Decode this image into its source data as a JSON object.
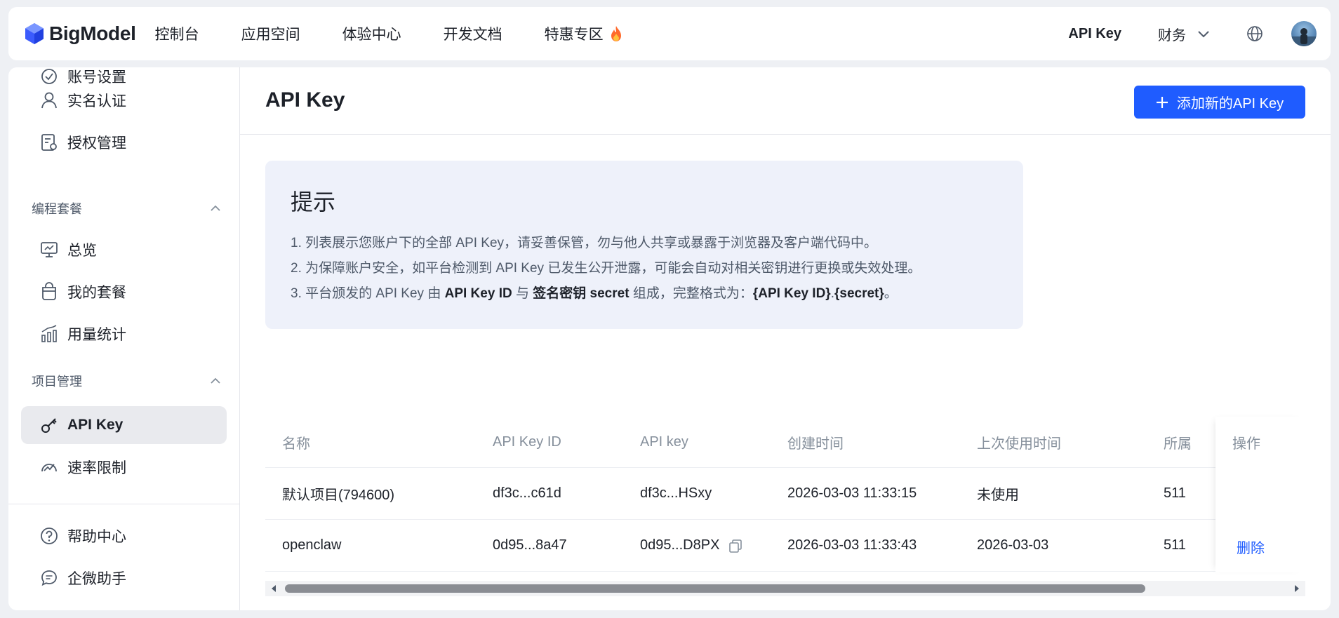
{
  "brand": {
    "name": "BigModel"
  },
  "nav": {
    "items": [
      {
        "label": "控制台"
      },
      {
        "label": "应用空间"
      },
      {
        "label": "体验中心"
      },
      {
        "label": "开发文档"
      },
      {
        "label": "特惠专区"
      }
    ],
    "api_key_label": "API Key",
    "finance_label": "财务"
  },
  "sidebar": {
    "top_partial": "账号设置",
    "account_items": [
      {
        "label": "实名认证",
        "icon": "user-icon"
      },
      {
        "label": "授权管理",
        "icon": "authorization-icon"
      }
    ],
    "group_coding": "编程套餐",
    "coding_items": [
      {
        "label": "总览",
        "icon": "monitor-icon"
      },
      {
        "label": "我的套餐",
        "icon": "package-icon"
      },
      {
        "label": "用量统计",
        "icon": "bar-chart-icon"
      }
    ],
    "group_project": "项目管理",
    "project_items": [
      {
        "label": "API Key",
        "icon": "key-icon",
        "active": true
      },
      {
        "label": "速率限制",
        "icon": "rate-limit-icon"
      }
    ],
    "footer_items": [
      {
        "label": "帮助中心",
        "icon": "help-icon"
      },
      {
        "label": "企微助手",
        "icon": "chat-icon"
      }
    ]
  },
  "page": {
    "title": "API Key",
    "add_button": "添加新的API Key"
  },
  "tip": {
    "title": "提示",
    "line1": "1. 列表展示您账户下的全部 API Key，请妥善保管，勿与他人共享或暴露于浏览器及客户端代码中。",
    "line2": "2. 为保障账户安全，如平台检测到 API Key 已发生公开泄露，可能会自动对相关密钥进行更换或失效处理。",
    "line3_a": "3. 平台颁发的 API Key 由 ",
    "line3_b": "API Key ID",
    "line3_c": " 与 ",
    "line3_d": "签名密钥 secret",
    "line3_e": " 组成，完整格式为：",
    "line3_f": "{API Key ID}",
    "line3_g": ".",
    "line3_h": "{secret}",
    "line3_i": "。"
  },
  "table": {
    "headers": [
      "名称",
      "API Key ID",
      "API key",
      "创建时间",
      "上次使用时间",
      "所属"
    ],
    "op_header": "操作",
    "rows": [
      {
        "name": "默认项目(794600)",
        "key_id": "df3c...c61d",
        "key": "df3c...HSxy",
        "created": "2026-03-03 11:33:15",
        "last_used": "未使用",
        "owner": "511"
      },
      {
        "name": "openclaw",
        "key_id": "0d95...8a47",
        "key": "0d95...D8PX",
        "created": "2026-03-03 11:33:43",
        "last_used": "2026-03-03",
        "owner": "511"
      }
    ],
    "delete_label": "删除"
  },
  "colors": {
    "primary": "#1f5cff",
    "tip_bg": "#eef1fa",
    "active_bg": "#e9eaee"
  }
}
